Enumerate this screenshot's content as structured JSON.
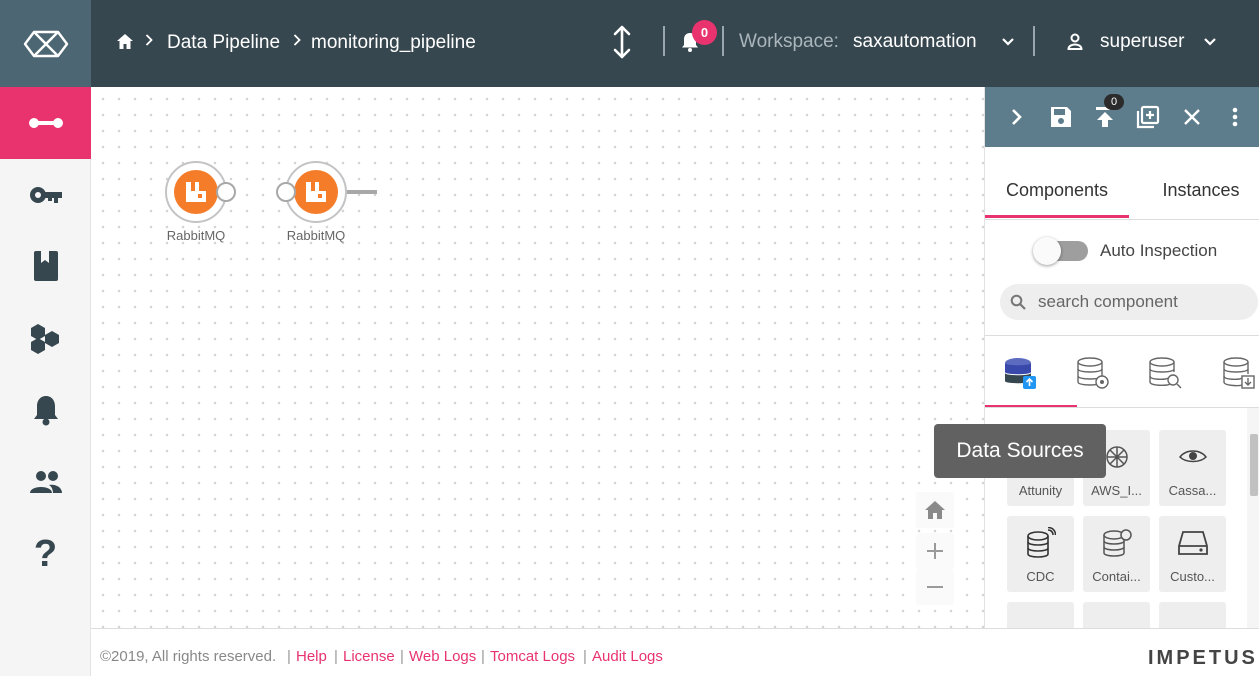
{
  "header": {
    "breadcrumb": [
      {
        "label": "Data Pipeline"
      },
      {
        "label": "monitoring_pipeline"
      }
    ],
    "notifications_count": "0",
    "workspace_label": "Workspace:",
    "workspace_name": "saxautomation",
    "user_name": "superuser"
  },
  "sidebar": {
    "items": [
      {
        "icon": "pipeline-icon",
        "active": true
      },
      {
        "icon": "key-icon"
      },
      {
        "icon": "book-icon"
      },
      {
        "icon": "cluster-icon"
      },
      {
        "icon": "bell-icon"
      },
      {
        "icon": "users-icon"
      },
      {
        "icon": "help-icon"
      }
    ]
  },
  "canvas": {
    "nodes": [
      {
        "label": "RabbitMQ"
      },
      {
        "label": "RabbitMQ"
      }
    ]
  },
  "tooltip": "Data Sources",
  "panel": {
    "toolbar": {
      "publish_badge": "0",
      "icons": [
        "chevron-right-icon",
        "save-icon",
        "publish-icon",
        "add-box-icon",
        "close-icon",
        "more-vert-icon"
      ]
    },
    "tabs": [
      "Components",
      "Instances"
    ],
    "auto_inspection_label": "Auto Inspection",
    "search_placeholder": "search component",
    "categories": [
      "data-sources-icon",
      "processors-icon",
      "analytics-icon",
      "emitters-icon"
    ],
    "components": [
      {
        "label": "Attunity"
      },
      {
        "label": "AWS_I..."
      },
      {
        "label": "Cassa..."
      },
      {
        "label": "CDC"
      },
      {
        "label": "Contai..."
      },
      {
        "label": "Custo..."
      }
    ]
  },
  "footer": {
    "copyright": "©2019, All rights reserved.",
    "links": [
      "Help",
      "License",
      "Web Logs",
      "Tomcat Logs",
      "Audit Logs"
    ],
    "brand": "IMPETUS"
  },
  "colors": {
    "accent": "#e8336f",
    "header_bg": "#37474f",
    "toolbar_bg": "#5e7d8c",
    "logo_bg": "#4c6674",
    "rabbitmq": "#f57c29"
  }
}
